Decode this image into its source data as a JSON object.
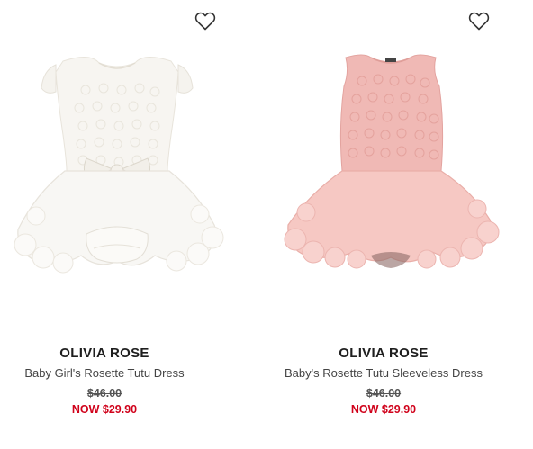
{
  "products": [
    {
      "brand": "OLIVIA ROSE",
      "name": "Baby Girl's Rosette Tutu Dress",
      "original_price": "$46.00",
      "sale_price": "NOW $29.90",
      "dress_color": "#f7f5f1",
      "icon": "heart-outline-icon"
    },
    {
      "brand": "OLIVIA ROSE",
      "name": "Baby's Rosette Tutu Sleeveless Dress",
      "original_price": "$46.00",
      "sale_price": "NOW $29.90",
      "dress_color": "#f0b9b5",
      "icon": "heart-outline-icon"
    }
  ],
  "colors": {
    "sale": "#d0021b",
    "brand_text": "#1e1e1e",
    "muted_text": "#444444"
  }
}
